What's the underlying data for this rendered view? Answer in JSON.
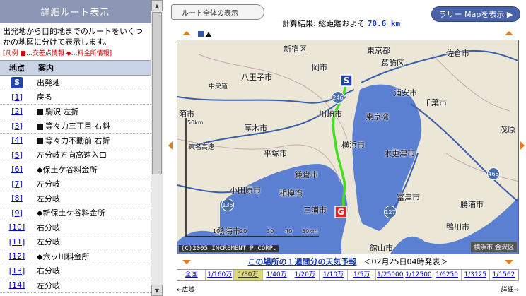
{
  "left": {
    "header": "詳細ルート表示",
    "intro": "出発地から目的地までのルートをいくつかの地図に分けて表示します。",
    "legend": "[凡例 ■…交差点情報 ◆…料金所情報]",
    "col_point": "地点",
    "col_guide": "案内",
    "start_badge": "S",
    "rows": [
      {
        "num": "",
        "text": "出発地",
        "marker": "start"
      },
      {
        "num": "[1]",
        "text": "戻る",
        "marker": ""
      },
      {
        "num": "[2]",
        "text": "駒沢 左折",
        "marker": "square"
      },
      {
        "num": "[3]",
        "text": "等々力三丁目 右斜",
        "marker": "square"
      },
      {
        "num": "[4]",
        "text": "等々力不動前 右折",
        "marker": "square"
      },
      {
        "num": "[5]",
        "text": "左分岐方向高速入口",
        "marker": ""
      },
      {
        "num": "[6]",
        "text": "◆保土ケ谷料金所",
        "marker": ""
      },
      {
        "num": "[7]",
        "text": "左分岐",
        "marker": ""
      },
      {
        "num": "[8]",
        "text": "左分岐",
        "marker": ""
      },
      {
        "num": "[9]",
        "text": "◆新保土ケ谷料金所",
        "marker": ""
      },
      {
        "num": "[10]",
        "text": "右分岐",
        "marker": ""
      },
      {
        "num": "[11]",
        "text": "左分岐",
        "marker": ""
      },
      {
        "num": "[12]",
        "text": "◆六ッ川料金所",
        "marker": ""
      },
      {
        "num": "[13]",
        "text": "右分岐",
        "marker": ""
      },
      {
        "num": "[14]",
        "text": "左分岐",
        "marker": ""
      }
    ]
  },
  "right": {
    "tab_whole": "ルート全体の表示",
    "rally_button": "ラリー Mapを表示 ▶",
    "calc_label": "計算結果: 総距離およそ",
    "calc_distance": "70.6 km",
    "copyright": "(C)2005 INCREMENT P CORP.",
    "place_tag": "横浜市 金沢区",
    "scale_bar": {
      "label_50": "50km",
      "ticks": [
        "10",
        "20",
        "30",
        "40",
        "50km"
      ]
    },
    "map_labels": {
      "shinjuku": "新宿区",
      "hachioji": "八王子市",
      "chuo": "中央道",
      "kawasaki": "川崎市",
      "atsugi": "厚木市",
      "yokohama": "横浜市",
      "hiratsuka": "平塚市",
      "kamakura": "鎌倉市",
      "sagami": "相模湾",
      "odawara": "小田原市",
      "atami": "熱海市",
      "miura": "三浦市",
      "tokyo_bay": "東京湾",
      "kisarazu": "木更津市",
      "futtsu": "富津市",
      "tateyama": "館山市",
      "urayasu": "浦安市",
      "chiba": "千葉市",
      "tokyo": "東京都",
      "katsushika": "葛飾区",
      "sakura": "佐倉市",
      "mobara": "茂原",
      "katsuura": "勝浦市",
      "kamogawa": "鴨川市",
      "yokoham_road": "東名高速",
      "miti": "岡市",
      "toko": "陌市"
    },
    "weather_link": "この場所の１週間分の天気予報",
    "weather_date": "＜02月25日04時発表＞",
    "scales": [
      "全国",
      "1/160万",
      "1/80万",
      "1/40万",
      "1/20万",
      "1/10万",
      "1/5万",
      "1/25000",
      "1/12500",
      "1/6250",
      "1/3125",
      "1/1562"
    ],
    "active_scale_index": 2,
    "zoom_out": "←広域",
    "zoom_in": "詳細→",
    "colors": {
      "sea": "#5b7fd1",
      "land": "#ebe6d6",
      "route": "#44dd22",
      "highway": "#3a5ea9"
    }
  }
}
